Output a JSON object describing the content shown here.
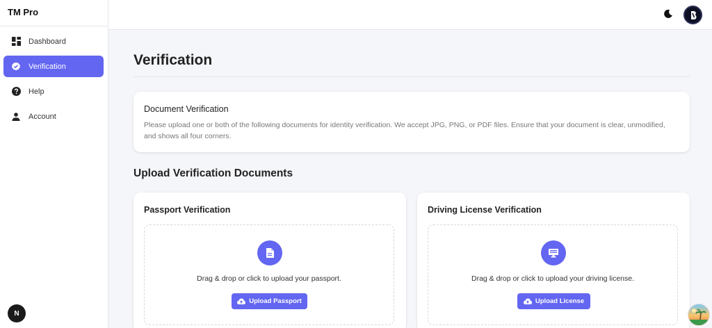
{
  "app": {
    "brand": "TM Pro"
  },
  "sidebar": {
    "items": [
      {
        "label": "Dashboard",
        "icon": "dashboard-icon"
      },
      {
        "label": "Verification",
        "icon": "verified-check-icon",
        "active": true
      },
      {
        "label": "Help",
        "icon": "help-icon"
      },
      {
        "label": "Account",
        "icon": "person-icon"
      }
    ],
    "badge": "N"
  },
  "header": {
    "theme_icon": "moon-icon",
    "avatar_icon": "logo-avatar-icon"
  },
  "main": {
    "title": "Verification",
    "info": {
      "heading": "Document Verification",
      "body": "Please upload one or both of the following documents for identity verification. We accept JPG, PNG, or PDF files. Ensure that your document is clear, unmodified, and shows all four corners."
    },
    "section_title": "Upload Verification Documents",
    "passport": {
      "title": "Passport Verification",
      "prompt": "Drag & drop or click to upload your passport.",
      "button": "Upload Passport",
      "icon": "document-icon"
    },
    "license": {
      "title": "Driving License Verification",
      "prompt": "Drag & drop or click to upload your driving license.",
      "button": "Upload License",
      "icon": "monitor-icon"
    }
  },
  "colors": {
    "accent": "#6366f1",
    "background": "#f5f6fa"
  }
}
